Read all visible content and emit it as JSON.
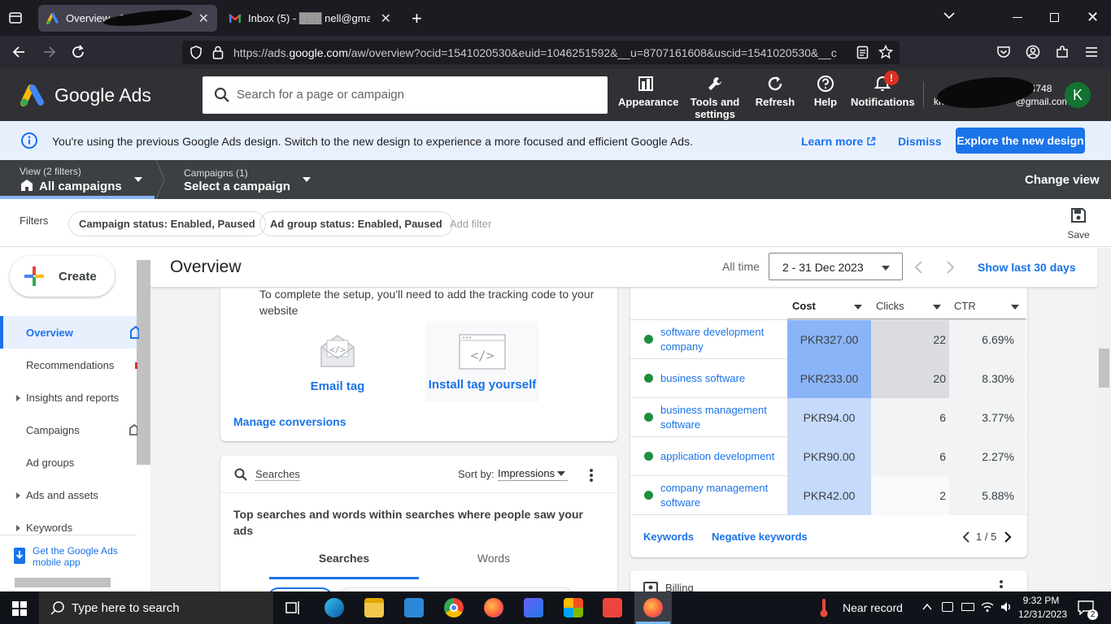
{
  "browser": {
    "tabs": [
      {
        "label": "Overview - 300",
        "active": true
      },
      {
        "label": "Inbox (5) - ",
        "label_suffix": "nell@gma",
        "active": false
      }
    ],
    "url_prefix": "https://ads.",
    "url_domain": "google.com",
    "url_rest": "/aw/overview?ocid=1541020530&euid=1046251592&__u=8707161608&uscid=1541020530&__c"
  },
  "header": {
    "product": "Google Ads",
    "search_placeholder": "Search for a page or campaign",
    "tools": [
      {
        "label": "Appearance",
        "icon": "appearance-icon"
      },
      {
        "label": "Tools and settings",
        "icon": "wrench-icon"
      },
      {
        "label": "Refresh",
        "icon": "refresh-icon"
      },
      {
        "label": "Help",
        "icon": "help-icon"
      },
      {
        "label": "Notifications",
        "icon": "bell-icon",
        "badge": "!"
      }
    ],
    "account_phone": "4-4748",
    "account_email_prefix": "kri",
    "account_email_suffix": "@gmail.com",
    "avatar_letter": "K"
  },
  "banner": {
    "text": "You're using the previous Google Ads design. Switch to the new design to experience a more focused and efficient Google Ads.",
    "learn_more": "Learn more",
    "dismiss": "Dismiss",
    "explore": "Explore the new design"
  },
  "campaign_bar": {
    "view_label": "View (2 filters)",
    "view_value": "All campaigns",
    "campaigns_label": "Campaigns (1)",
    "campaigns_value": "Select a campaign",
    "change_view": "Change view"
  },
  "filters": {
    "label": "Filters",
    "chips": [
      "Campaign status: Enabled, Paused",
      "Ad group status: Enabled, Paused"
    ],
    "add_filter": "Add filter",
    "save": "Save"
  },
  "sidebar": {
    "create": "Create",
    "items": [
      {
        "label": "Overview",
        "selected": true
      },
      {
        "label": "Recommendations"
      },
      {
        "label": "Insights and reports",
        "expandable": true
      },
      {
        "label": "Campaigns"
      },
      {
        "label": "Ad groups"
      },
      {
        "label": "Ads and assets",
        "expandable": true
      },
      {
        "label": "Keywords",
        "expandable": true
      }
    ],
    "mobile_app": "Get the Google Ads mobile app"
  },
  "overview": {
    "title": "Overview",
    "all_time": "All time",
    "date_range": "2 - 31 Dec 2023",
    "show_last": "Show last 30 days"
  },
  "conversion_card": {
    "setup_text": "To complete the setup, you'll need to add the tracking code to your website",
    "email_tag": "Email tag",
    "install_tag": "Install tag yourself",
    "manage": "Manage conversions"
  },
  "searches_card": {
    "title": "Searches",
    "sort_by": "Sort by:",
    "sort_value": "Impressions",
    "description": "Top searches and words within searches where people saw your ads",
    "tabs": [
      "Searches",
      "Words"
    ]
  },
  "keywords_card": {
    "columns": [
      "Cost",
      "Clicks",
      "CTR"
    ],
    "rows": [
      {
        "keyword": "software development company",
        "cost": "PKR327.00",
        "clicks": "22",
        "ctr": "6.69%"
      },
      {
        "keyword": "business software",
        "cost": "PKR233.00",
        "clicks": "20",
        "ctr": "8.30%"
      },
      {
        "keyword": "business management software",
        "cost": "PKR94.00",
        "clicks": "6",
        "ctr": "3.77%"
      },
      {
        "keyword": "application development",
        "cost": "PKR90.00",
        "clicks": "6",
        "ctr": "2.27%"
      },
      {
        "keyword": "company management software",
        "cost": "PKR42.00",
        "clicks": "2",
        "ctr": "5.88%"
      }
    ],
    "links": [
      "Keywords",
      "Negative keywords"
    ],
    "pagination": "1 / 5",
    "next_card": "Billing"
  },
  "taskbar": {
    "search_placeholder": "Type here to search",
    "weather": "Near record",
    "time": "9:32 PM",
    "date": "12/31/2023",
    "notifications": "2"
  },
  "colors": {
    "brand_blue": "#1a73e8",
    "status_green": "#1e8e3e",
    "cost_heat_high": "#8ab4f8",
    "cost_heat_low": "#c6dafc"
  }
}
